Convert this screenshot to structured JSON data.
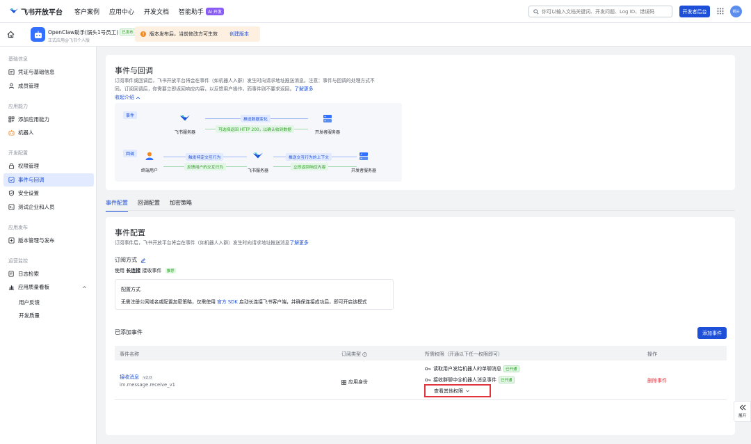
{
  "topbar": {
    "logo_text": "飞书开放平台",
    "nav": [
      "客户案例",
      "应用中心",
      "开发文档",
      "智能助手"
    ],
    "ai_badge": "AI 开发",
    "search_placeholder": "你可以输入文档关键词、开发问题、Log ID、错误码",
    "dev_console": "开发者后台",
    "avatar_text": "锅头"
  },
  "appbar": {
    "app_name": "OpenClaw助手(锅头1号员工)",
    "app_status": "已发布",
    "app_sub": "正式应用@飞书个人版",
    "notice": "版本发布后，当前修改方可生效",
    "notice_link": "创建版本"
  },
  "sidebar": {
    "groups": [
      "基础信息",
      "应用能力",
      "开发配置",
      "应用发布",
      "运营监控"
    ],
    "items": {
      "credentials": "凭证与基础信息",
      "members": "成员管理",
      "add_capability": "添加应用能力",
      "bot": "机器人",
      "permissions": "权限管理",
      "events": "事件与回调",
      "security": "安全设置",
      "test_company": "测试企业和人员",
      "version": "版本管理与发布",
      "logs": "日志检索",
      "quality": "应用质量看板",
      "feedback": "用户反馈",
      "dev_quality": "开发质量"
    }
  },
  "intro": {
    "title": "事件与回调",
    "desc1": "订阅事件或回调后，飞书开放平台将会在事件（如机器人入群）发生时向请求地址推送消息。注意：事件与回调的处理方式不",
    "desc2": "同。订阅回调后，你需要立即返回响应内容，以反馈用户操作，而事件则不要求返回。",
    "learn_more": "了解更多",
    "collapse": "收起介绍"
  },
  "diagram": {
    "event_tag": "事件",
    "callback_tag": "回调",
    "feishu_server": "飞书服务器",
    "dev_server": "开发者服务器",
    "end_user": "终端用户",
    "push_change": "推送数据变化",
    "return_200": "可选择返回 HTTP 200，以确认收到数据",
    "trigger": "触发特定交互行为",
    "feedback": "反馈用户的交互行为",
    "push_context": "推送交互行为的上下文",
    "return_content": "立即返回响应内容"
  },
  "tabs": [
    "事件配置",
    "回调配置",
    "加密策略"
  ],
  "event_config": {
    "title": "事件配置",
    "desc": "订阅事件后，飞书开放平台将会在事件（如机器人入群）发生时向请求地址推送消息",
    "learn_more": "了解更多",
    "sub_method": "订阅方式",
    "use_prefix": "使用",
    "long_conn": "长连接",
    "receive": "接收事件",
    "recommend": "推荐",
    "config_title": "配置方式",
    "config_desc_a": "无需注册公网域名或配置加密策略，仅需使用",
    "config_link": "官方 SDK",
    "config_desc_b": "启动长连接飞书客户端，并确保连接成功后，即可开启该模式",
    "added_events": "已添加事件",
    "add_event": "添加事件"
  },
  "table": {
    "headers": [
      "事件名称",
      "订阅类型",
      "所需权限（开通以下任一权限即可）",
      "操作"
    ],
    "row": {
      "event_name": "接收消息",
      "version": "v2.0",
      "event_key": "im.message.receive_v1",
      "sub_type": "应用身份",
      "perm1": "读取用户发给机器人的单聊消息",
      "perm1_status": "已开通",
      "perm2": "接收群聊中@机器人消息事件",
      "perm2_status": "已开通",
      "view_more": "查看其他权限",
      "delete": "删除事件"
    }
  },
  "expand": "展开",
  "colors": {
    "primary": "#1d4fd8",
    "danger": "#e0353f",
    "success": "#2ea121"
  }
}
